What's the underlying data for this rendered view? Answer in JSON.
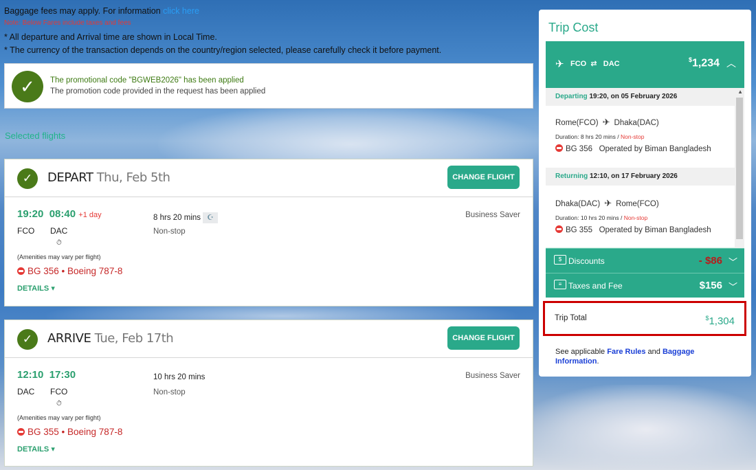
{
  "info": {
    "baggage_text": "Baggage fees may apply. For information",
    "baggage_link": "click here",
    "note": "Note: Below Fares include taxes and fees",
    "line1": "* All departure and Arrival time are shown in Local Time.",
    "line2": "* The currency of the transaction depends on the country/region selected, please carefully check it before payment."
  },
  "promo": {
    "title": "The promotional code \"BGWEB2026\" has been applied",
    "subtitle": "The promotion code provided in the request has been applied"
  },
  "selected_flights_label": "Selected flights",
  "flights": [
    {
      "direction": "DEPART",
      "date": "Thu, Feb 5th",
      "change_label": "CHANGE FLIGHT",
      "dep_time": "19:20",
      "arr_time": "08:40",
      "plus_day": "+1 day",
      "from": "FCO",
      "to": "DAC",
      "amenities": "(Amenities may vary per flight)",
      "flight_no": "BG 356",
      "aircraft": "Boeing 787-8",
      "details": "DETAILS",
      "duration": "8 hrs 20 mins",
      "stops": "Non-stop",
      "cabin": "Business Saver"
    },
    {
      "direction": "ARRIVE",
      "date": "Tue, Feb 17th",
      "change_label": "CHANGE FLIGHT",
      "dep_time": "12:10",
      "arr_time": "17:30",
      "plus_day": "",
      "from": "DAC",
      "to": "FCO",
      "amenities": "(Amenities may vary per flight)",
      "flight_no": "BG 355",
      "aircraft": "Boeing 787-8",
      "details": "DETAILS",
      "duration": "10 hrs 20 mins",
      "stops": "Non-stop",
      "cabin": "Business Saver"
    }
  ],
  "trip_cost": {
    "title": "Trip Cost",
    "route_from": "FCO",
    "route_to": "DAC",
    "total_route_price": "1,234",
    "currency": "$",
    "departing": {
      "label": "Departing",
      "when": "19:20, on 05 February 2026",
      "route_from": "Rome(FCO)",
      "route_to": "Dhaka(DAC)",
      "duration": "Duration: 8 hrs 20 mins /",
      "stops": "Non-stop",
      "flight": "BG 356",
      "operator": "Operated by Biman Bangladesh"
    },
    "returning": {
      "label": "Returning",
      "when": "12:10, on 17 February 2026",
      "route_from": "Dhaka(DAC)",
      "route_to": "Rome(FCO)",
      "duration": "Duration: 10 hrs 20 mins /",
      "stops": "Non-stop",
      "flight": "BG 355",
      "operator": "Operated by Biman Bangladesh"
    },
    "discounts": {
      "label": "Discounts",
      "value": "- $86"
    },
    "taxes": {
      "label": "Taxes and Fee",
      "value": "$156"
    },
    "trip_total": {
      "label": "Trip Total",
      "value": "1,304"
    },
    "rules": {
      "prefix": "See applicable",
      "fare_rules": "Fare Rules",
      "and": "and",
      "baggage": "Baggage Information",
      "suffix": "."
    }
  },
  "colors": {
    "accent": "#2aa98a",
    "success": "#4a7a19",
    "alert": "#cc0000"
  }
}
